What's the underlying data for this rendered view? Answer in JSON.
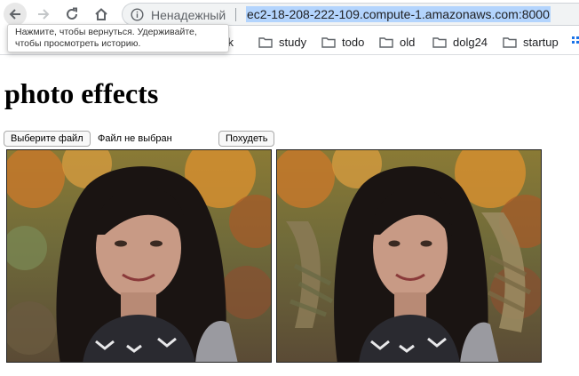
{
  "toolbar": {
    "security_label": "Ненадежный",
    "url": "ec2-18-208-222-109.compute-1.amazonaws.com:8000"
  },
  "tooltip": {
    "line1": "Нажмите, чтобы вернуться. Удерживайте,",
    "line2": "чтобы просмотреть историю."
  },
  "bookmarks": [
    {
      "label": "ork"
    },
    {
      "label": "study"
    },
    {
      "label": "todo"
    },
    {
      "label": "old"
    },
    {
      "label": "dolg24"
    },
    {
      "label": "startup"
    }
  ],
  "page": {
    "title": "photo effects",
    "file_button": "Выберите файл",
    "file_status": "Файл не выбран",
    "action_button": "Похудеть"
  },
  "icons": {
    "back": "back-arrow-icon",
    "forward": "forward-arrow-icon",
    "reload": "reload-icon",
    "home": "home-icon",
    "info": "info-icon",
    "folder": "folder-icon"
  },
  "colors": {
    "url_highlight": "#b3d4fd",
    "omnibox_bg": "#f1f3f4"
  }
}
